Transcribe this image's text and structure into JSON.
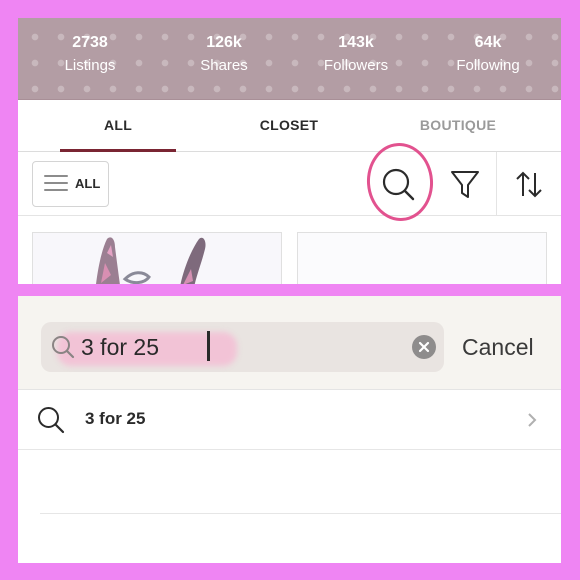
{
  "profile_stats": [
    {
      "value": "2738",
      "label": "Listings"
    },
    {
      "value": "126k",
      "label": "Shares"
    },
    {
      "value": "143k",
      "label": "Followers"
    },
    {
      "value": "64k",
      "label": "Following"
    }
  ],
  "tabs": [
    {
      "label": "ALL",
      "selected": true
    },
    {
      "label": "CLOSET",
      "selected": false
    },
    {
      "label": "BOUTIQUE",
      "selected": false
    }
  ],
  "toolbar": {
    "filter_label": "ALL",
    "icons": [
      "menu-icon",
      "search-icon",
      "filter-icon",
      "sort-icon"
    ]
  },
  "search": {
    "value": "3 for 25",
    "cancel_label": "Cancel"
  },
  "suggestions": [
    {
      "text": "3 for 25"
    }
  ],
  "colors": {
    "background_border": "#ef85f3",
    "stats_bar": "#b39da4",
    "tab_underline": "#7a2533",
    "highlight_ring": "#e2528f",
    "search_highlight": "#f2c3d6"
  }
}
